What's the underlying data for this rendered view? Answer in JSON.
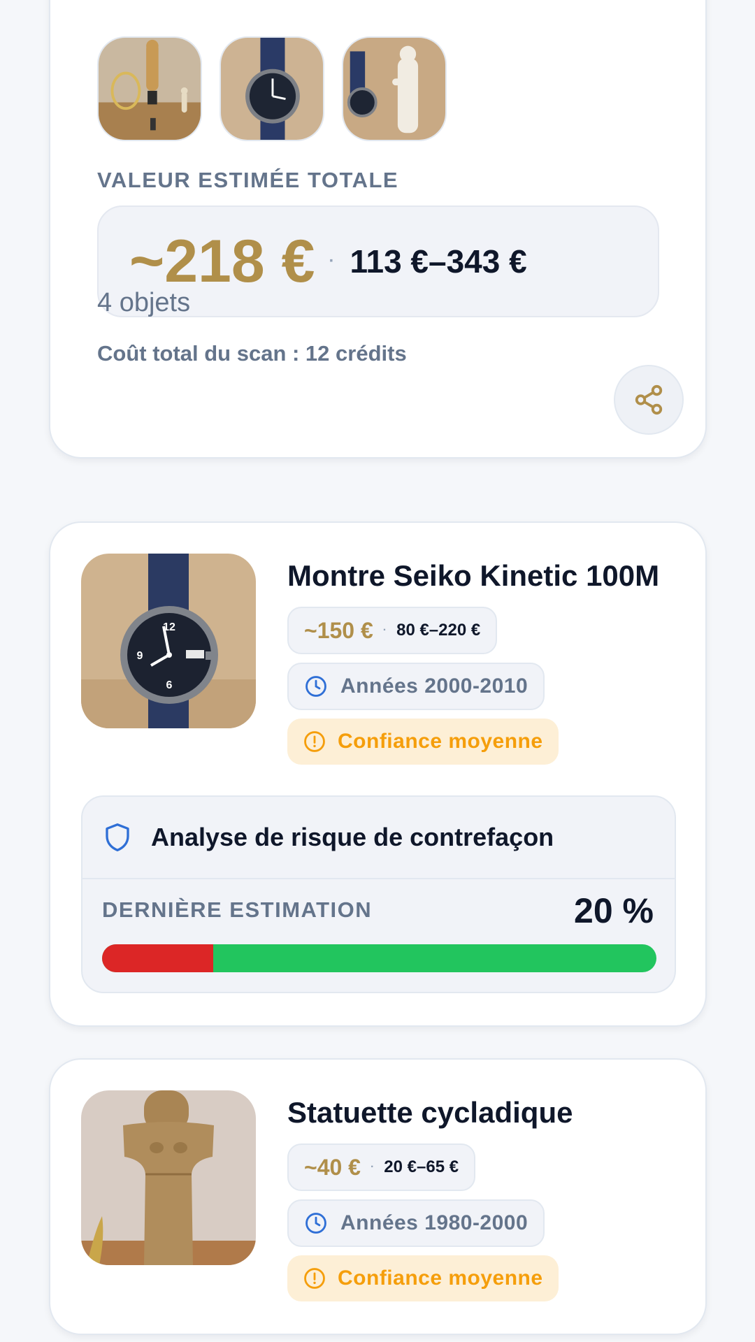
{
  "summary": {
    "section_label": "VALEUR ESTIMÉE TOTALE",
    "total_value": "~218 €",
    "separator": "·",
    "total_range": "113 €–343 €",
    "objects_count": "4 objets",
    "scan_cost": "Coût total du scan : 12 crédits",
    "thumbnails": [
      {
        "icon": "statues-photo"
      },
      {
        "icon": "watch-photo"
      },
      {
        "icon": "watch-and-statue-photo"
      }
    ]
  },
  "items": [
    {
      "title": "Montre Seiko Kinetic 100M",
      "price": "~150 €",
      "separator": "·",
      "range": "80 €–220 €",
      "era": "Années 2000-2010",
      "confidence": "Confiance moyenne",
      "risk": {
        "title": "Analyse de risque de contrefaçon",
        "label": "DERNIÈRE ESTIMATION",
        "value_text": "20 %",
        "value": 0.2
      }
    },
    {
      "title": "Statuette cycladique",
      "price": "~40 €",
      "separator": "·",
      "range": "20 €–65 €",
      "era": "Années 1980-2000",
      "confidence": "Confiance moyenne"
    }
  ],
  "colors": {
    "gold": "#b08f4a",
    "warning": "#f59e0b",
    "warning_bg": "#fdefd6",
    "risk_red": "#dc2626",
    "risk_green": "#22c55e",
    "clock_blue": "#2f6fd6"
  }
}
